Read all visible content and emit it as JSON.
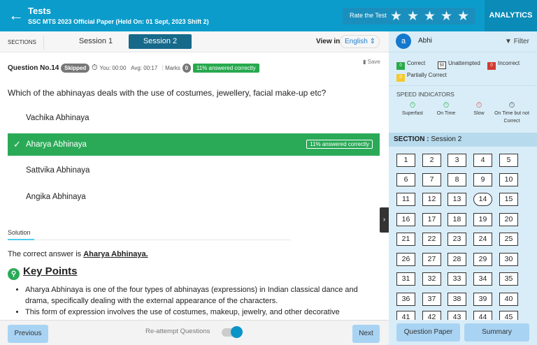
{
  "header": {
    "title": "Tests",
    "subtitle": "SSC MTS 2023 Official Paper (Held On: 01 Sept, 2023 Shift 2)",
    "rate_label": "Rate the Test",
    "stars": 5,
    "analytics": "ANALYTICS"
  },
  "sections": {
    "label": "SECTIONS",
    "tabs": [
      "Session 1",
      "Session 2"
    ],
    "view_in": "View in",
    "language": "English"
  },
  "question": {
    "number": "Question No.14",
    "status": "Skipped",
    "you": "You: 00:00",
    "avg": "Avg: 00:17",
    "marks_label": "Marks",
    "marks": "0",
    "answered": "11% answered correctly",
    "save": "Save",
    "text": "Which of the abhinayas deals with the use of costumes, jewellery, facial make-up etc?",
    "options": [
      "Vachika Abhinaya",
      "Aharya Abhinaya",
      "Sattvika Abhinaya",
      "Angika Abhinaya"
    ],
    "selected_badge": "11% answered correctly"
  },
  "solution": {
    "tab": "Solution",
    "answer_prefix": "The correct answer is ",
    "answer": "Aharya Abhinaya.",
    "key_points": "Key Points",
    "bullets": [
      " Aharya Abhinaya is one of the four types of abhinayas (expressions) in Indian classical dance and drama, specifically dealing with the external appearance of the characters.",
      "This form of expression involves the use of costumes, makeup, jewelry, and other decorative"
    ]
  },
  "footer": {
    "previous": "Previous",
    "reattempt": "Re-attempt Questions",
    "reattempt_on": true,
    "next": "Next",
    "question_paper": "Question Paper",
    "summary": "Summary"
  },
  "sidebar": {
    "avatar": "a",
    "user": "Abhi",
    "filter": "Filter",
    "legend": [
      {
        "count": "0",
        "label": "Correct",
        "color": "#2aaa4a"
      },
      {
        "count": "50",
        "label": "Unattempted",
        "color": "#ffffff"
      },
      {
        "count": "0",
        "label": "Incorrect",
        "color": "#d13a32"
      },
      {
        "count": "0",
        "label": "Partially Correct",
        "color": "#f5c92e"
      }
    ],
    "speed_title": "SPEED INDICATORS",
    "speed": [
      {
        "label": "Superfast",
        "color": "#2aaa4a"
      },
      {
        "label": "On Time",
        "color": "#2aaa4a"
      },
      {
        "label": "Slow",
        "color": "#e0474c"
      },
      {
        "label": "On Time but not Correct",
        "color": "#444444"
      }
    ],
    "section_label": "SECTION :",
    "section_name": "Session 2",
    "questions": [
      "1",
      "2",
      "3",
      "4",
      "5",
      "6",
      "7",
      "8",
      "9",
      "10",
      "11",
      "12",
      "13",
      "14",
      "15",
      "16",
      "17",
      "18",
      "19",
      "20",
      "21",
      "22",
      "23",
      "24",
      "25",
      "26",
      "27",
      "28",
      "29",
      "30",
      "31",
      "32",
      "33",
      "34",
      "35",
      "36",
      "37",
      "38",
      "39",
      "40",
      "41",
      "42",
      "43",
      "44",
      "45"
    ],
    "current": "14"
  }
}
